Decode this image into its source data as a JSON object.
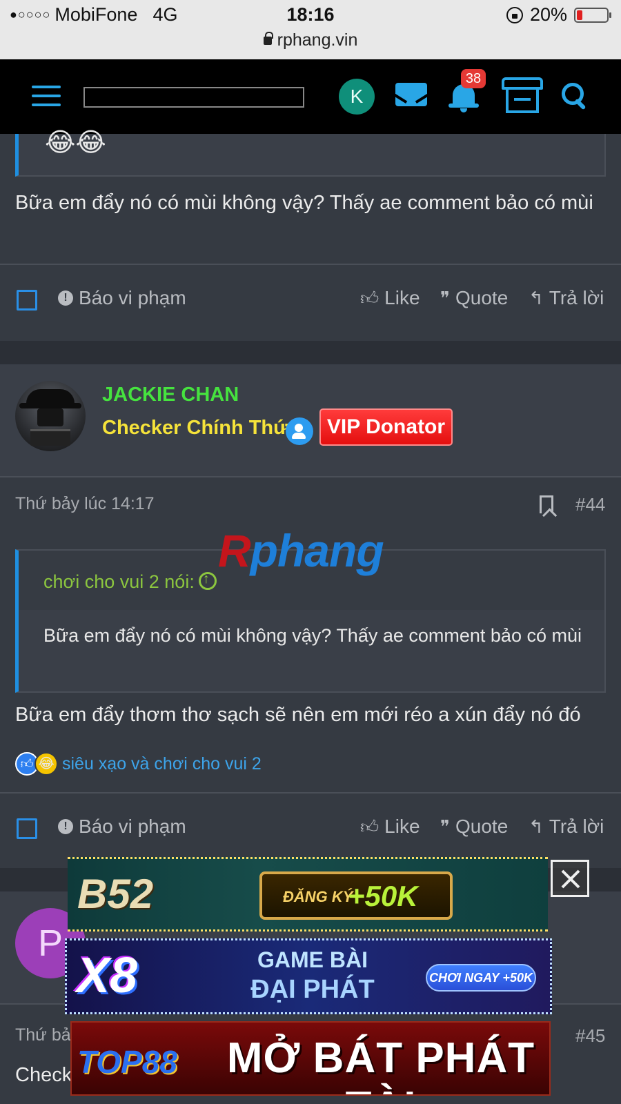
{
  "status_bar": {
    "signal_dots": "●○○○○",
    "carrier": "MobiFone",
    "network": "4G",
    "time": "18:16",
    "battery": "20%",
    "battery_level": 0.2,
    "url": "rphang.vin"
  },
  "nav": {
    "avatar_letter": "K",
    "notification_count": "38",
    "search_placeholder": ""
  },
  "post1": {
    "emojis": "😂😂",
    "text": "Bữa em đẩy nó có mùi không vậy? Thấy ae comment bảo có mùi"
  },
  "actions": {
    "report": "Báo vi phạm",
    "like": "Like",
    "quote": "Quote",
    "reply": "Trả lời"
  },
  "post2": {
    "username": "JACKIE CHAN",
    "user_title": "Checker Chính Thức",
    "vip_badge": "VIP Donator",
    "date": "Thứ bảy lúc 14:17",
    "post_number": "#44",
    "watermark_r": "R",
    "watermark_rest": "phang",
    "quote_author": "chơi cho vui 2 nói:",
    "quote_text": "Bữa em đẩy nó có mùi không vậy? Thấy ae comment bảo có mùi",
    "text": "Bữa em đẩy thơm thơ sạch sẽ nên em mới réo a xún đẩy nó đó",
    "reactors": "siêu xạo và chơi cho vui 2"
  },
  "post3": {
    "avatar_letter": "P",
    "date_partial": "Thứ bả",
    "post_number": "#45",
    "text_partial": "Check"
  },
  "ads": {
    "b52_logo": "B52",
    "b52_register": "ĐĂNG KÝ",
    "b52_bonus": "+50K",
    "x8_logo": "X8",
    "x8_line1": "GAME BÀI",
    "x8_line2": "ĐẠI PHÁT",
    "x8_button": "CHƠI NGAY +50K",
    "top88_logo": "TOP88",
    "top88_slogan": "MỞ BÁT PHÁT TÀI"
  }
}
